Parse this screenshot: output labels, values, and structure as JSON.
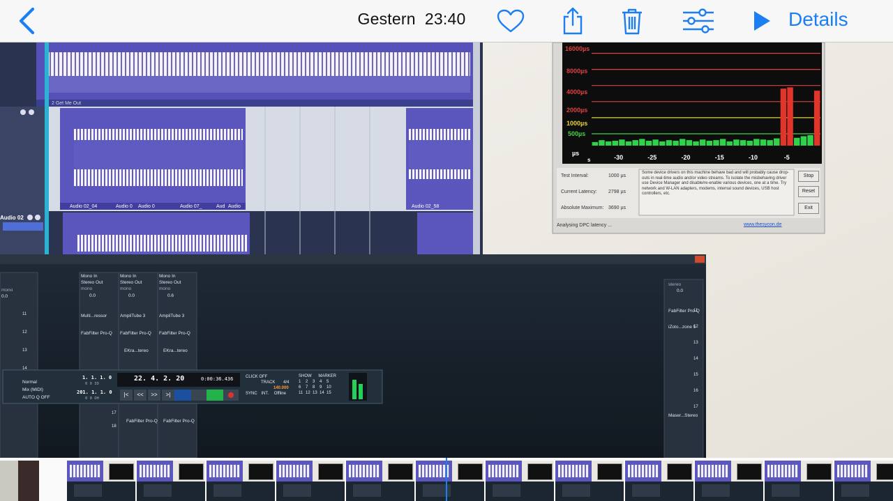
{
  "toolbar": {
    "back_icon": "chevron-left-icon",
    "date_label": "Gestern",
    "time_label": "23:40",
    "details_label": "Details",
    "icons": [
      "heart-icon",
      "share-icon",
      "trash-icon",
      "adjust-sliders-icon",
      "play-icon"
    ],
    "accent": "#1b7ff3"
  },
  "daw": {
    "tracks": [
      {
        "name": "2 Get Me Out"
      },
      {
        "name": "Audio 02"
      }
    ],
    "clips": [
      "Audio 02_04",
      "Audio 0",
      "Audio 0",
      "Audio 07_",
      "Aud",
      "Audio",
      "Audio 02_58"
    ],
    "channels": [
      {
        "input": "Mono In",
        "output": "Stereo Out",
        "mode": "mono",
        "gain": "0.0",
        "insert1": "Multi...ressor",
        "insert2": "FabFilter Pro-Q",
        "insert3": ""
      },
      {
        "input": "Mono In",
        "output": "Stereo Out",
        "mode": "mono",
        "gain": "0.0",
        "insert1": "AmpliTube 3",
        "insert2": "FabFilter Pro-Q",
        "insert3": "EKra...tereo"
      },
      {
        "input": "Mono In",
        "output": "Stereo Out",
        "mode": "mono",
        "gain": "0.6",
        "insert1": "AmpliTube 3",
        "insert2": "FabFilter Pro-Q",
        "insert3": "EKra...tereo"
      }
    ],
    "left_channel": {
      "mode": "mono",
      "gain": "0.0"
    },
    "right_channel": {
      "mode": "stereo",
      "gain": "0.0",
      "insert1": "FabFilter Pro-Q",
      "insert2": "iZoto...zone 5",
      "bottom_insert": "Maser...Stereo"
    },
    "row_numbers": [
      "11",
      "12",
      "13",
      "14"
    ],
    "row_numbers_right": [
      "11",
      "12",
      "13",
      "14",
      "15",
      "16",
      "17"
    ],
    "lower_slots": {
      "slot_17": "17",
      "slot_18": "18",
      "insert_a": "FabFilter Pro-Q",
      "insert_b": "FabFilter Pro-Q"
    },
    "transport": {
      "mode": "Normal",
      "mix": "Mix (MIDI)",
      "auto": "AUTO Q OFF",
      "left_locator": "1. 1. 1. 0",
      "left_sub": "0  0  ID",
      "right_locator": "201. 1. 1. 0",
      "right_sub": "0  0  OH",
      "position_bars": "22. 4. 2. 20",
      "position_time": "0:00:36.436",
      "click": "CLICK  OFF",
      "track": "TRACK",
      "signature": "4/4",
      "tempo": "140.000",
      "sync": "SYNC",
      "int": "INT.",
      "offline": "Offline",
      "show": "SHOW",
      "marker": "MARKER",
      "marker_numbers": [
        "1",
        "2",
        "3",
        "4",
        "5",
        "6",
        "7",
        "8",
        "9",
        "10",
        "11",
        "12",
        "13",
        "14",
        "15"
      ]
    }
  },
  "latency": {
    "y_labels": [
      "16000µs",
      "8000µs",
      "4000µs",
      "2000µs",
      "1000µs",
      "500µs"
    ],
    "x_labels": [
      "-30",
      "-25",
      "-20",
      "-15",
      "-10",
      "-5"
    ],
    "unit_top": "µs",
    "unit_right": "s",
    "test_interval_label": "Test Interval:",
    "test_interval_value": "1000 µs",
    "current_latency_label": "Current Latency:",
    "current_latency_value": "2798 µs",
    "absolute_max_label": "Absolute Maximum:",
    "absolute_max_value": "3690 µs",
    "message": "Some device drivers on this machine behave bad and will probably cause drop-outs in real-time audio and/or video streams. To isolate the misbehaving driver use Device Manager and disable/re-enable various devices, one at a time. Try network and W-LAN adapters, modems, internal sound devices, USB host controllers, etc.",
    "stop_label": "Stop",
    "reset_label": "Reset",
    "exit_label": "Exit",
    "status": "Analysing DPC latency ...",
    "link": "www.thesycon.de"
  },
  "chart_data": {
    "type": "bar",
    "xlabel": "s",
    "ylabel": "µs",
    "x": [
      -33,
      -32,
      -31,
      -30,
      -29,
      -28,
      -27,
      -26,
      -25,
      -24,
      -23,
      -22,
      -21,
      -20,
      -19,
      -18,
      -17,
      -16,
      -15,
      -14,
      -13,
      -12,
      -11,
      -10,
      -9,
      -8,
      -7,
      -6,
      -5,
      -4,
      -3,
      -2,
      -1,
      0
    ],
    "values": [
      350,
      380,
      360,
      370,
      390,
      360,
      380,
      400,
      370,
      390,
      360,
      380,
      370,
      400,
      380,
      360,
      390,
      370,
      380,
      400,
      360,
      390,
      380,
      370,
      400,
      390,
      380,
      410,
      3500,
      3690,
      420,
      450,
      470,
      3200
    ],
    "ylim": [
      0,
      24000
    ],
    "xlim": [
      -34,
      0
    ],
    "y_scale": "log",
    "colors": {
      "normal": "#2fd24a",
      "alert": "#e3342a"
    },
    "thresholds": [
      {
        "value": 16000,
        "color": "#d84545"
      },
      {
        "value": 8000,
        "color": "#d84545"
      },
      {
        "value": 4000,
        "color": "#d84545"
      },
      {
        "value": 2000,
        "color": "#d84545"
      },
      {
        "value": 1000,
        "color": "#e8d43a"
      },
      {
        "value": 500,
        "color": "#46d24a"
      }
    ]
  }
}
